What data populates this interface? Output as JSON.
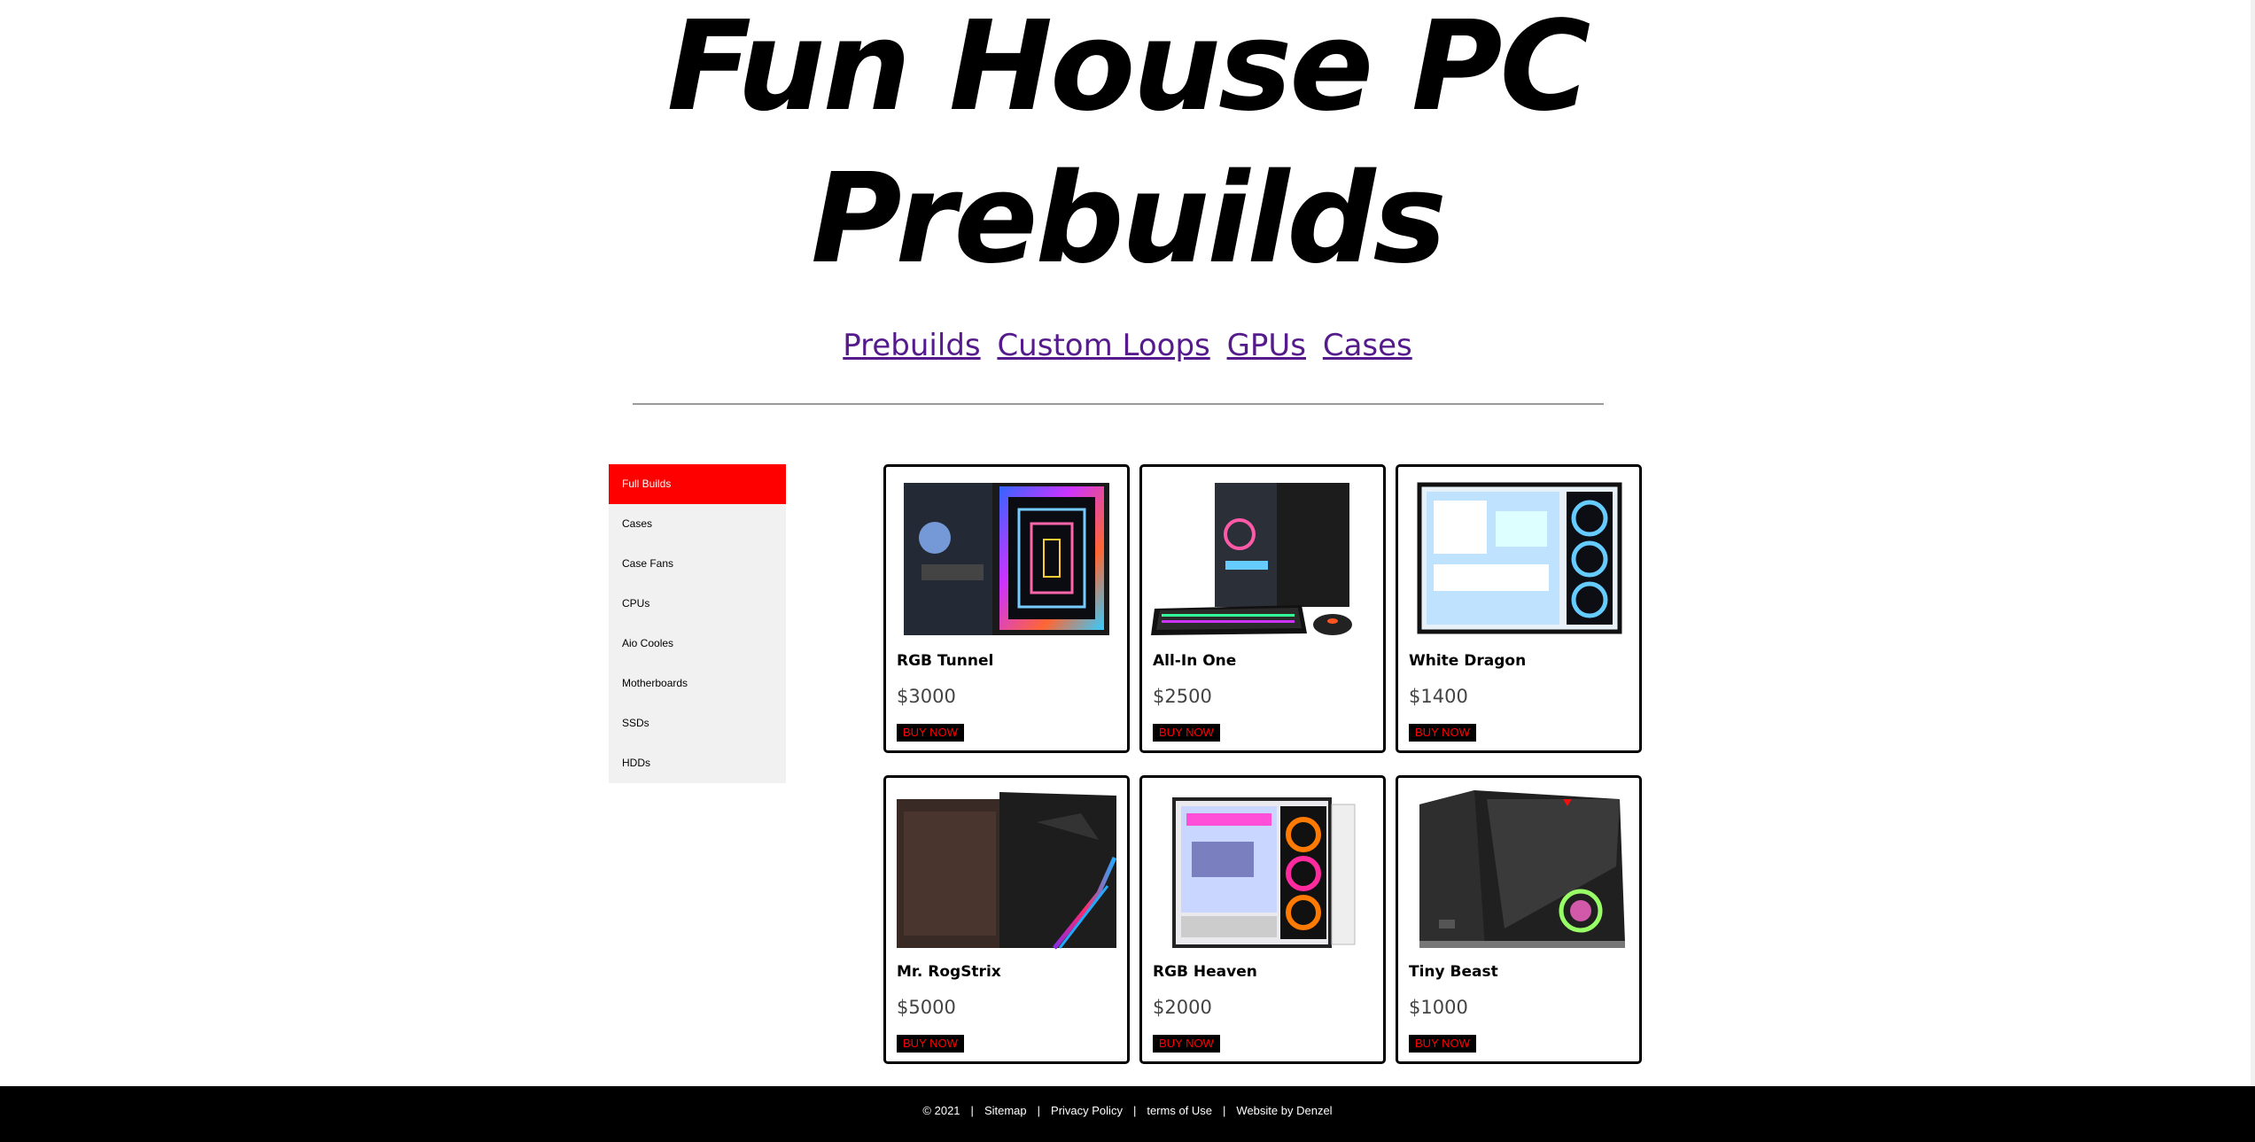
{
  "header": {
    "title_line1": "Fun House PC",
    "title_line2": "Prebuilds"
  },
  "nav": {
    "links": [
      {
        "label": "Prebuilds"
      },
      {
        "label": "Custom Loops"
      },
      {
        "label": "GPUs"
      },
      {
        "label": "Cases"
      }
    ],
    "link_color": "#551a8b"
  },
  "sidebar": {
    "active_color": "#ff0000",
    "items": [
      {
        "label": "Full Builds",
        "active": true
      },
      {
        "label": "Cases"
      },
      {
        "label": "Case Fans"
      },
      {
        "label": "CPUs"
      },
      {
        "label": "Aio Cooles"
      },
      {
        "label": "Motherboards"
      },
      {
        "label": "SSDs"
      },
      {
        "label": "HDDs"
      }
    ]
  },
  "products": [
    {
      "name": "RGB Tunnel",
      "price": "$3000",
      "button": "BUY NOW",
      "image_icon": "pc-case-rgb-tunnel-icon"
    },
    {
      "name": "All-In One",
      "price": "$2500",
      "button": "BUY NOW",
      "image_icon": "pc-case-with-keyboard-icon"
    },
    {
      "name": "White Dragon",
      "price": "$1400",
      "button": "BUY NOW",
      "image_icon": "pc-case-white-icon"
    },
    {
      "name": "Mr. RogStrix",
      "price": "$5000",
      "button": "BUY NOW",
      "image_icon": "pc-case-rog-icon"
    },
    {
      "name": "RGB Heaven",
      "price": "$2000",
      "button": "BUY NOW",
      "image_icon": "pc-case-rgb-fans-icon"
    },
    {
      "name": "Tiny Beast",
      "price": "$1000",
      "button": "BUY NOW",
      "image_icon": "pc-case-msi-icon"
    }
  ],
  "footer": {
    "copyright": "© 2021",
    "sitemap": "Sitemap",
    "privacy": "Privacy Policy",
    "terms": "terms of Use",
    "credit": "Website by Denzel",
    "separator": "|"
  }
}
